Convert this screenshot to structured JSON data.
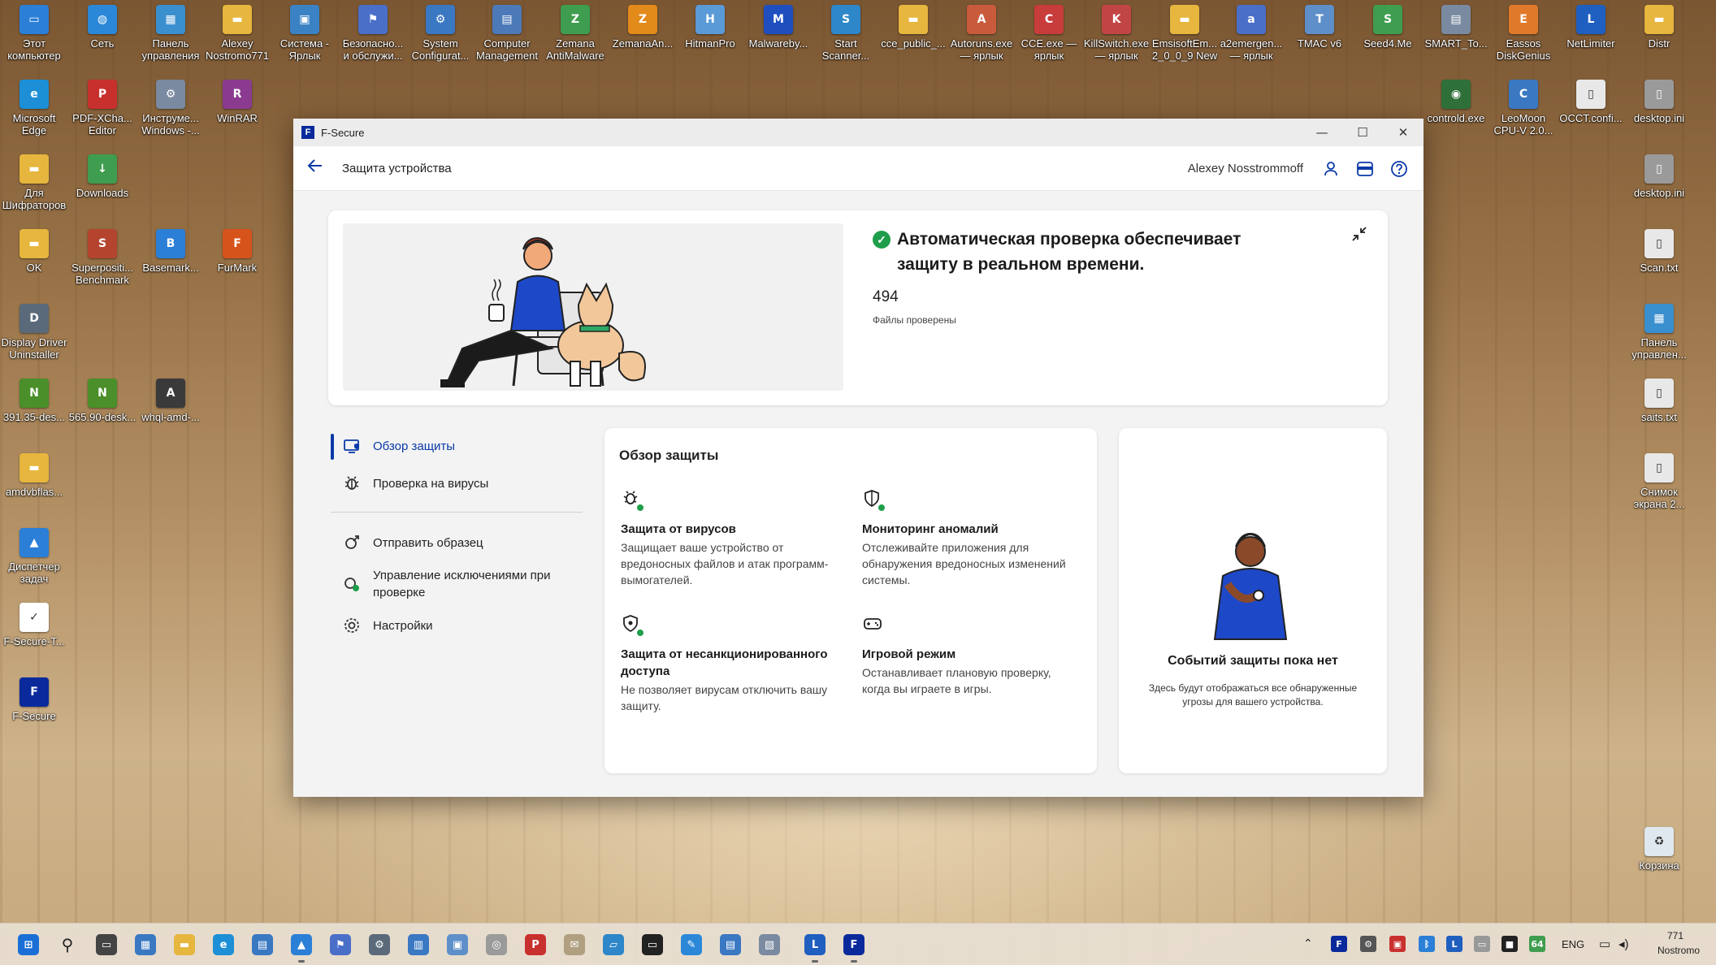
{
  "desktop": {
    "icons": [
      {
        "label": "Этот\nкомпьютер",
        "glyph": "▭",
        "color": "#2b7fd6"
      },
      {
        "label": "Сеть",
        "glyph": "◍",
        "color": "#2b88d8"
      },
      {
        "label": "Панель\nуправления",
        "glyph": "▦",
        "color": "#3a8fcf"
      },
      {
        "label": "Alexey\nNostromo771",
        "glyph": "▬",
        "color": "#e6b63e"
      },
      {
        "label": "Система -\nЯрлык",
        "glyph": "▣",
        "color": "#3b82c4"
      },
      {
        "label": "Безопасно...\nи обслужи...",
        "glyph": "⚑",
        "color": "#4a6fc9"
      },
      {
        "label": "System\nConfigurat...",
        "glyph": "⚙",
        "color": "#3a78c2"
      },
      {
        "label": "Computer\nManagement",
        "glyph": "▤",
        "color": "#4c7ab8"
      },
      {
        "label": "Zemana\nAntiMalware",
        "glyph": "Z",
        "color": "#3f9d4f"
      },
      {
        "label": "ZemanaAn...",
        "glyph": "Z",
        "color": "#e28a1a"
      },
      {
        "label": "HitmanPro",
        "glyph": "H",
        "color": "#5a9ad6"
      },
      {
        "label": "Malwareby...",
        "glyph": "M",
        "color": "#1f4fbf"
      },
      {
        "label": "Start\nScanner...",
        "glyph": "S",
        "color": "#2d87c9"
      },
      {
        "label": "cce_public_...",
        "glyph": "▬",
        "color": "#e6b63e"
      },
      {
        "label": "Autoruns.exe\n— ярлык",
        "glyph": "A",
        "color": "#c95b3c"
      },
      {
        "label": "CCE.exe —\nярлык",
        "glyph": "C",
        "color": "#c83c3c"
      },
      {
        "label": "KillSwitch.exe\n— ярлык",
        "glyph": "K",
        "color": "#c24545"
      },
      {
        "label": "EmsisoftEm...\n2_0_0_9 New",
        "glyph": "▬",
        "color": "#e6b63e"
      },
      {
        "label": "a2emergen...\n— ярлык",
        "glyph": "a",
        "color": "#4a6fc9"
      },
      {
        "label": "TMAC v6",
        "glyph": "T",
        "color": "#5f8fc8"
      },
      {
        "label": "Seed4.Me",
        "glyph": "S",
        "color": "#3f9d4f"
      },
      {
        "label": "SMART_To...",
        "glyph": "▤",
        "color": "#7a8aa0"
      },
      {
        "label": "Eassos\nDiskGenius",
        "glyph": "E",
        "color": "#e07a2a"
      },
      {
        "label": "NetLimiter",
        "glyph": "L",
        "color": "#1f5fbf"
      },
      {
        "label": "Distr",
        "glyph": "▬",
        "color": "#e6b63e"
      },
      {
        "label": "Microsoft\nEdge",
        "glyph": "e",
        "color": "#1c8fd6"
      },
      {
        "label": "PDF-XCha...\nEditor",
        "glyph": "P",
        "color": "#c8302e"
      },
      {
        "label": "Инструме...\nWindows -...",
        "glyph": "⚙",
        "color": "#7a8aa0"
      },
      {
        "label": "WinRAR",
        "glyph": "R",
        "color": "#8a3b8f"
      },
      {
        "label": "controld.exe",
        "glyph": "◉",
        "color": "#2f6f3a"
      },
      {
        "label": "LeoMoon\nCPU-V 2.0...",
        "glyph": "C",
        "color": "#3a78c2"
      },
      {
        "label": "OCCT.confi...",
        "glyph": "▯",
        "color": "#e8e8e8"
      },
      {
        "label": "desktop.ini",
        "glyph": "▯",
        "color": "#9a9a9a"
      },
      {
        "label": "Для\nШифраторов",
        "glyph": "▬",
        "color": "#e6b63e"
      },
      {
        "label": "Downloads",
        "glyph": "↓",
        "color": "#3f9d4f"
      },
      {
        "label": "desktop.ini",
        "glyph": "▯",
        "color": "#9a9a9a"
      },
      {
        "label": "OK",
        "glyph": "▬",
        "color": "#e6b63e"
      },
      {
        "label": "Superpositi...\nBenchmark",
        "glyph": "S",
        "color": "#b5442f"
      },
      {
        "label": "Basemark...",
        "glyph": "B",
        "color": "#2b7fd6"
      },
      {
        "label": "FurMark",
        "glyph": "F",
        "color": "#d6531c"
      },
      {
        "label": "Scan.txt",
        "glyph": "▯",
        "color": "#e8e8e8"
      },
      {
        "label": "Display Driver\nUninstaller",
        "glyph": "D",
        "color": "#5a6a7a"
      },
      {
        "label": "Панель\nуправлен...",
        "glyph": "▦",
        "color": "#3a8fcf"
      },
      {
        "label": "391.35-des...",
        "glyph": "N",
        "color": "#4a8f2a"
      },
      {
        "label": "565.90-desk...",
        "glyph": "N",
        "color": "#4a8f2a"
      },
      {
        "label": "whql-amd-...",
        "glyph": "A",
        "color": "#3a3a3a"
      },
      {
        "label": "saits.txt",
        "glyph": "▯",
        "color": "#e8e8e8"
      },
      {
        "label": "amdvbflas...",
        "glyph": "▬",
        "color": "#e6b63e"
      },
      {
        "label": "Снимок\nэкрана 2...",
        "glyph": "▯",
        "color": "#e8e8e8"
      },
      {
        "label": "Диспетчер\nзадач",
        "glyph": "▲",
        "color": "#2b7fd6"
      },
      {
        "label": "F-Secure-T...",
        "glyph": "✓",
        "color": "#ffffff"
      },
      {
        "label": "F-Secure",
        "glyph": "F",
        "color": "#0a2a9c"
      },
      {
        "label": "Корзина",
        "glyph": "♻",
        "color": "#dfe8ef"
      }
    ]
  },
  "window": {
    "title": "F-Secure",
    "controls": {
      "minimize": "—",
      "maximize": "☐",
      "close": "✕"
    }
  },
  "header": {
    "back_icon": "arrow-left-icon",
    "page_title": "Защита устройства",
    "user_name": "Alexey Nosstrommoff"
  },
  "hero": {
    "status_text": "Автоматическая проверка обеспечивает защиту в реальном времени.",
    "files_count": "494",
    "files_label": "Файлы проверены"
  },
  "nav": {
    "items": [
      {
        "label": "Обзор защиты",
        "icon": "monitor-shield-icon"
      },
      {
        "label": "Проверка на вирусы",
        "icon": "bug-icon"
      },
      {
        "label": "Отправить образец",
        "icon": "send-sample-icon"
      },
      {
        "label": "Управление исключениями при проверке",
        "icon": "exclusions-icon"
      },
      {
        "label": "Настройки",
        "icon": "gear-icon"
      }
    ]
  },
  "overview": {
    "title": "Обзор защиты",
    "features": [
      {
        "title": "Защита от вирусов",
        "desc": "Защищает ваше устройство от вредоносных файлов и атак программ-вымогателей."
      },
      {
        "title": "Мониторинг аномалий",
        "desc": "Отслеживайте приложения для обнаружения вредоносных изменений системы."
      },
      {
        "title": "Защита от несанкционированного доступа",
        "desc": "Не позволяет вирусам отключить вашу защиту."
      },
      {
        "title": "Игровой режим",
        "desc": "Останавливает плановую проверку, когда вы играете в игры."
      }
    ]
  },
  "events": {
    "title": "Событий защиты пока нет",
    "desc": "Здесь будут отображаться все обнаруженные угрозы для вашего устройства."
  },
  "taskbar": {
    "lang": "ENG",
    "time": "771",
    "user": "Nostromo"
  },
  "colors": {
    "accent": "#0a3aa8",
    "ok": "#1e9e4a"
  }
}
